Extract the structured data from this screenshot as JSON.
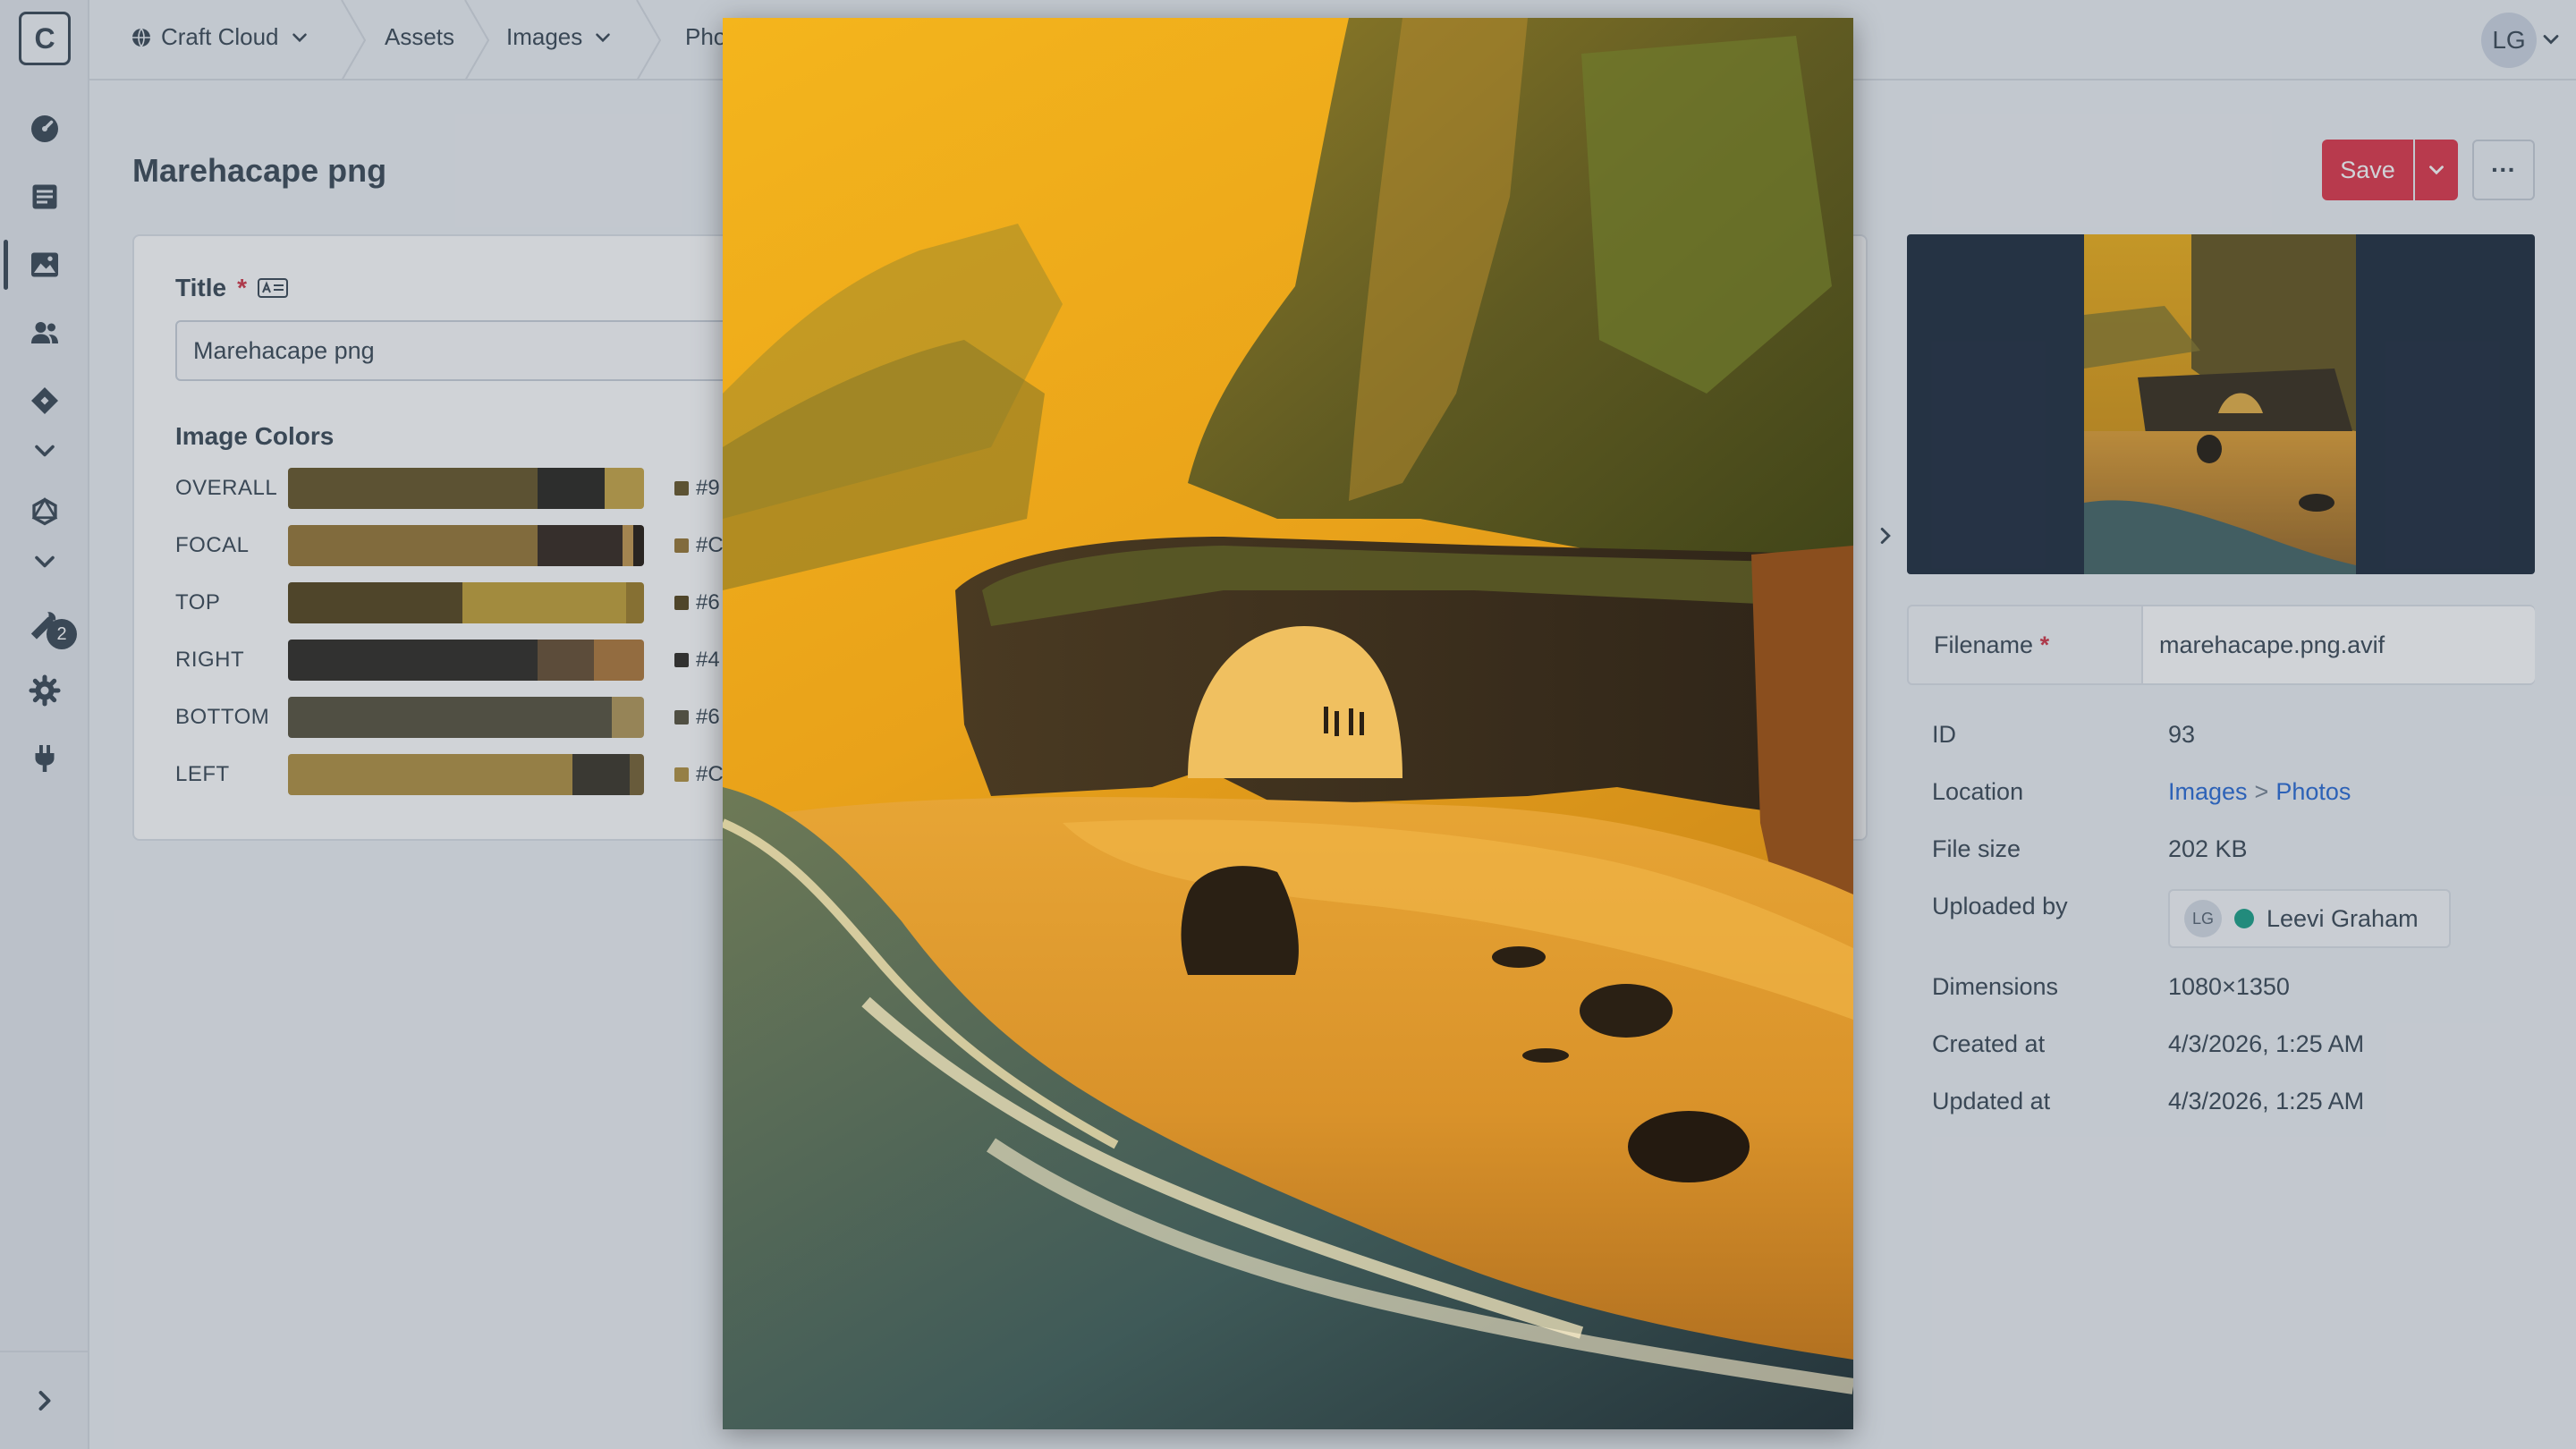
{
  "app": {
    "site_name": "Craft Cloud",
    "user_initials": "LG"
  },
  "sidebar": {
    "badge_count": "2"
  },
  "breadcrumbs": [
    {
      "label": "Craft Cloud"
    },
    {
      "label": "Assets"
    },
    {
      "label": "Images"
    },
    {
      "label": "Pho"
    }
  ],
  "page": {
    "title": "Marehacape png",
    "save_label": "Save",
    "more_label": "···"
  },
  "form": {
    "title_label": "Title",
    "required_mark": "*",
    "title_value": "Marehacape png",
    "image_colors_heading": "Image Colors",
    "color_rows": [
      {
        "label": "OVERALL",
        "hex": "#9",
        "swatches": [
          {
            "color": "#6b5a2e",
            "share": 0.7
          },
          {
            "color": "#2f2c26",
            "share": 0.19
          },
          {
            "color": "#c9a84a",
            "share": 0.11
          }
        ]
      },
      {
        "label": "FOCAL",
        "hex": "#C",
        "swatches": [
          {
            "color": "#9a7a3a",
            "share": 0.7
          },
          {
            "color": "#3a2e24",
            "share": 0.24
          },
          {
            "color": "#c69a52",
            "share": 0.03
          },
          {
            "color": "#2a2018",
            "share": 0.03
          }
        ]
      },
      {
        "label": "TOP",
        "hex": "#6",
        "swatches": [
          {
            "color": "#5a4a22",
            "share": 0.49
          },
          {
            "color": "#c5a33c",
            "share": 0.46
          },
          {
            "color": "#a0802e",
            "share": 0.05
          }
        ]
      },
      {
        "label": "RIGHT",
        "hex": "#4",
        "swatches": [
          {
            "color": "#34302a",
            "share": 0.7
          },
          {
            "color": "#6b5236",
            "share": 0.16
          },
          {
            "color": "#b17b3e",
            "share": 0.14
          }
        ]
      },
      {
        "label": "BOTTOM",
        "hex": "#6",
        "swatches": [
          {
            "color": "#5b5642",
            "share": 0.91
          },
          {
            "color": "#b59a5c",
            "share": 0.09
          }
        ]
      },
      {
        "label": "LEFT",
        "hex": "#C",
        "swatches": [
          {
            "color": "#b49446",
            "share": 0.8
          },
          {
            "color": "#3f3a2e",
            "share": 0.16
          },
          {
            "color": "#7a6638",
            "share": 0.04
          }
        ]
      }
    ]
  },
  "details": {
    "filename_label": "Filename",
    "filename_value": "marehacape.png.avif",
    "id_label": "ID",
    "id_value": "93",
    "location_label": "Location",
    "location_parent": "Images",
    "location_sep": ">",
    "location_child": "Photos",
    "filesize_label": "File size",
    "filesize_value": "202 KB",
    "uploaded_by_label": "Uploaded by",
    "uploader_initials": "LG",
    "uploader_name": "Leevi Graham",
    "dimensions_label": "Dimensions",
    "dimensions_value": "1080×1350",
    "created_label": "Created at",
    "created_value": "4/3/2026, 1:25 AM",
    "updated_label": "Updated at",
    "updated_value": "4/3/2026, 1:25 AM"
  },
  "colors": {
    "accent_save": "#e03c4f",
    "link": "#2f6fd6",
    "uploader_status": "#21a38b"
  }
}
